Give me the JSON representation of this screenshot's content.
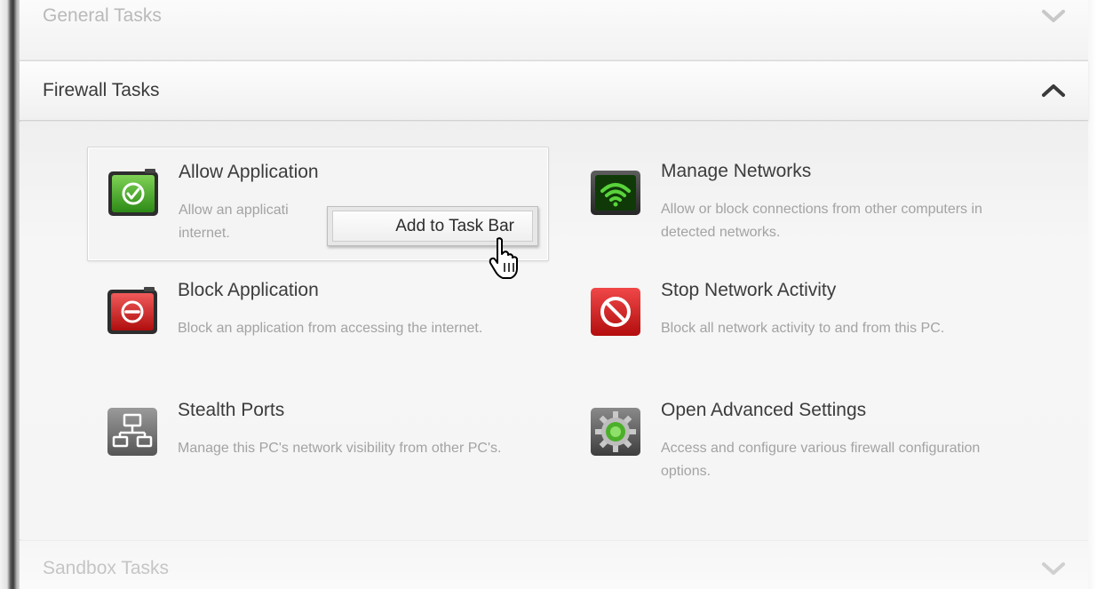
{
  "sections": {
    "general": {
      "title": "General Tasks",
      "state": "collapsed"
    },
    "firewall": {
      "title": "Firewall Tasks",
      "state": "expanded"
    },
    "sandbox": {
      "title": "Sandbox Tasks",
      "state": "collapsed"
    }
  },
  "tasks": [
    {
      "title": "Allow Application",
      "description": "Allow an applicati... internet.",
      "desc_left": "Allow an applicati",
      "desc_right": "...",
      "desc_line2": "internet.",
      "icon": "allow-application-icon",
      "color": "#2f9a22"
    },
    {
      "title": "Manage Networks",
      "description": "Allow or block connections from other computers in detected networks.",
      "icon": "wifi-icon",
      "color": "#1f7a16"
    },
    {
      "title": "Block Application",
      "description": "Block an application from accessing the internet.",
      "icon": "block-application-icon",
      "color": "#d11e1e"
    },
    {
      "title": "Stop Network Activity",
      "description": "Block all network activity to and from this PC.",
      "icon": "stop-icon",
      "color": "#d81a1a"
    },
    {
      "title": "Stealth Ports",
      "description": "Manage this PC's network visibility from other PC's.",
      "icon": "network-computers-icon",
      "color": "#6a6a6a"
    },
    {
      "title": "Open Advanced Settings",
      "description": "Access and configure various firewall configuration options.",
      "icon": "gear-icon",
      "color": "#4caf2a"
    }
  ],
  "context_menu": {
    "items": [
      {
        "label": "Add to Task Bar"
      }
    ]
  }
}
